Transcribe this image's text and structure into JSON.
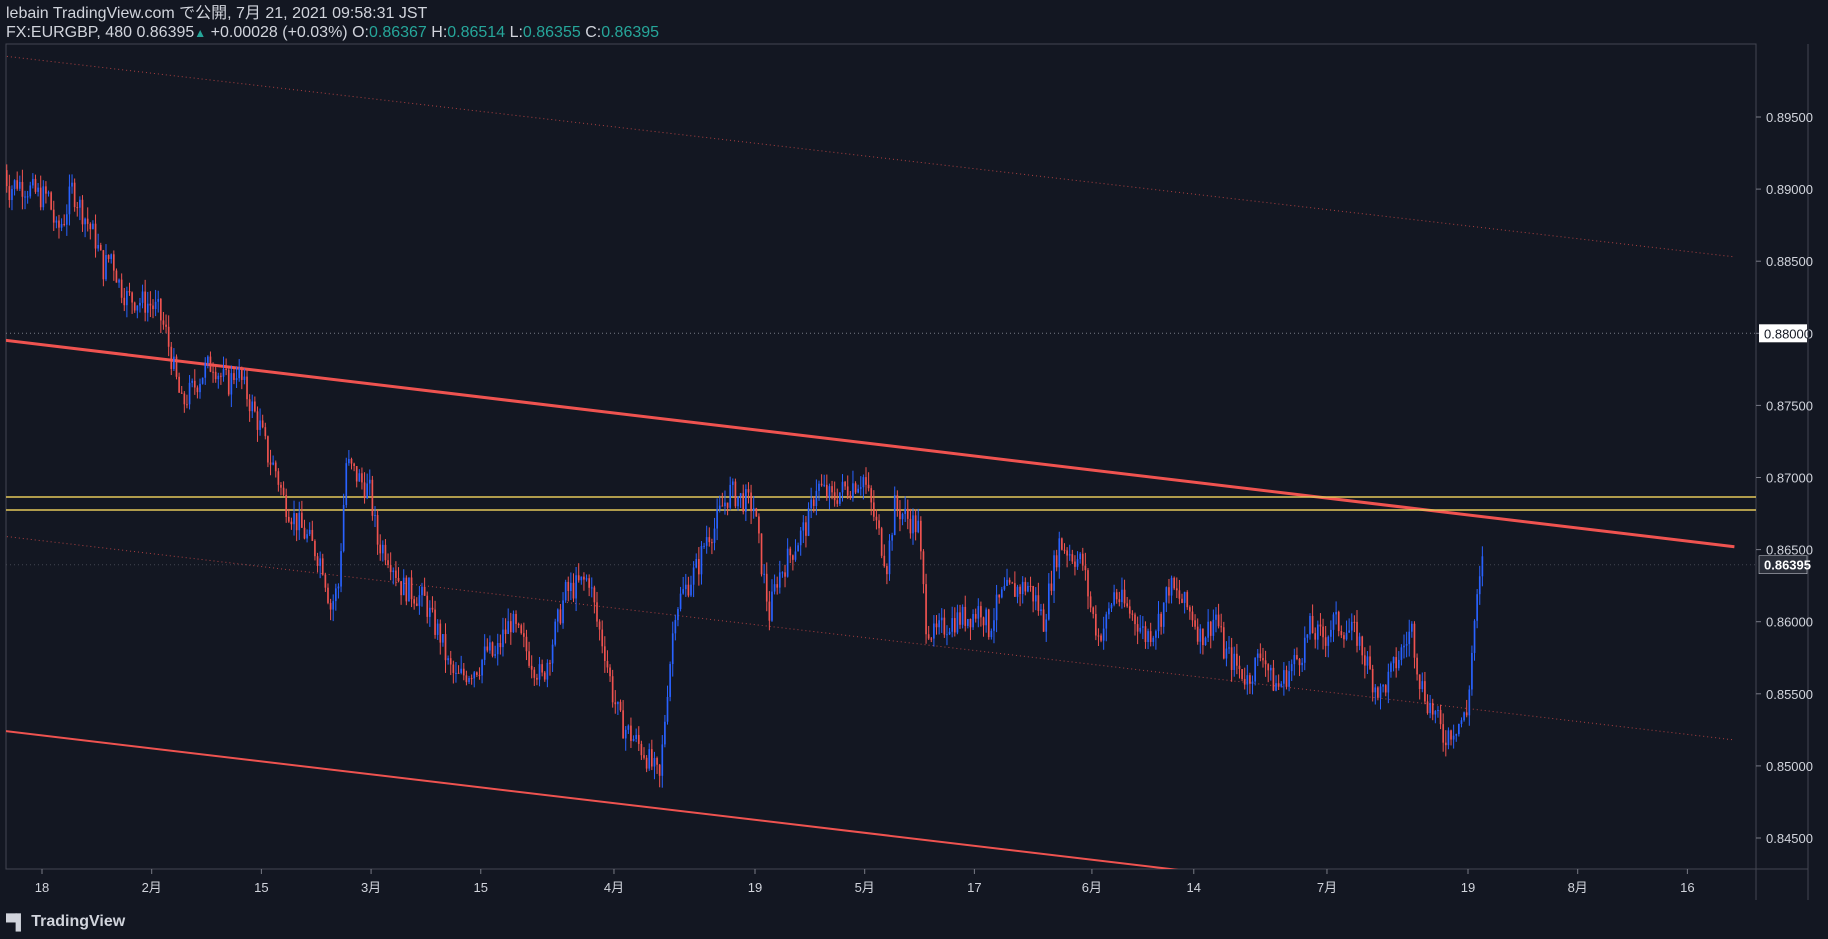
{
  "header": {
    "line1": "lebain TradingView.com で公開, 7月 21, 2021 09:58:31 JST",
    "symbol": "FX:EURGBP, 480",
    "last": "0.86395",
    "change": "+0.00028 (+0.03%)",
    "o_label": "O:",
    "o_value": "0.86367",
    "h_label": "H:",
    "h_value": "0.86514",
    "l_label": "L:",
    "l_value": "0.86355",
    "c_label": "C:",
    "c_value": "0.86395"
  },
  "logo": {
    "text": "TradingView",
    "icon": "tradingview-logo-icon"
  },
  "colors": {
    "background": "#131722",
    "up": "#2962ff",
    "down": "#ef5350",
    "trendline": "#ef5350",
    "zone": "#e5c85a",
    "text": "#d1d4dc"
  },
  "chart_data": {
    "type": "candlestick",
    "symbol": "FX:EURGBP",
    "timeframe": "480",
    "ylim": [
      0.8428,
      0.899
    ],
    "x_ticks": [
      {
        "label": "18",
        "date": "2021-01-18"
      },
      {
        "label": "2月",
        "date": "2021-02-01"
      },
      {
        "label": "15",
        "date": "2021-02-15"
      },
      {
        "label": "3月",
        "date": "2021-03-01"
      },
      {
        "label": "15",
        "date": "2021-03-15"
      },
      {
        "label": "4月",
        "date": "2021-04-01"
      },
      {
        "label": "19",
        "date": "2021-04-19"
      },
      {
        "label": "5月",
        "date": "2021-05-03"
      },
      {
        "label": "17",
        "date": "2021-05-17"
      },
      {
        "label": "6月",
        "date": "2021-06-01"
      },
      {
        "label": "14",
        "date": "2021-06-14"
      },
      {
        "label": "7月",
        "date": "2021-07-01"
      },
      {
        "label": "19",
        "date": "2021-07-19"
      },
      {
        "label": "8月",
        "date": "2021-08-02"
      },
      {
        "label": "16",
        "date": "2021-08-16"
      }
    ],
    "y_ticks": [
      "0.84500",
      "0.85000",
      "0.85500",
      "0.86000",
      "0.86500",
      "0.87000",
      "0.87500",
      "0.88000",
      "0.88500",
      "0.89000",
      "0.89500"
    ],
    "current_price": "0.86395",
    "marked_price": "0.88000",
    "path": [
      [
        "2021-01-13",
        0.892
      ],
      [
        "2021-01-14",
        0.89
      ],
      [
        "2021-01-15",
        0.8905
      ],
      [
        "2021-01-18",
        0.8895
      ],
      [
        "2021-01-19",
        0.8895
      ],
      [
        "2021-01-20",
        0.887
      ],
      [
        "2021-01-21",
        0.888
      ],
      [
        "2021-01-22",
        0.89
      ],
      [
        "2021-01-25",
        0.8865
      ],
      [
        "2021-01-26",
        0.8845
      ],
      [
        "2021-01-27",
        0.8855
      ],
      [
        "2021-01-28",
        0.8835
      ],
      [
        "2021-01-29",
        0.8825
      ],
      [
        "2021-02-01",
        0.882
      ],
      [
        "2021-02-02",
        0.8815
      ],
      [
        "2021-02-03",
        0.88
      ],
      [
        "2021-02-04",
        0.8775
      ],
      [
        "2021-02-05",
        0.875
      ],
      [
        "2021-02-08",
        0.8775
      ],
      [
        "2021-02-09",
        0.878
      ],
      [
        "2021-02-10",
        0.877
      ],
      [
        "2021-02-11",
        0.8765
      ],
      [
        "2021-02-12",
        0.8775
      ],
      [
        "2021-02-15",
        0.8735
      ],
      [
        "2021-02-16",
        0.8715
      ],
      [
        "2021-02-17",
        0.8705
      ],
      [
        "2021-02-18",
        0.8685
      ],
      [
        "2021-02-19",
        0.8675
      ],
      [
        "2021-02-22",
        0.865
      ],
      [
        "2021-02-23",
        0.864
      ],
      [
        "2021-02-24",
        0.861
      ],
      [
        "2021-02-25",
        0.8625
      ],
      [
        "2021-02-26",
        0.871
      ],
      [
        "2021-03-01",
        0.869
      ],
      [
        "2021-03-02",
        0.8655
      ],
      [
        "2021-03-03",
        0.865
      ],
      [
        "2021-03-04",
        0.864
      ],
      [
        "2021-03-05",
        0.8625
      ],
      [
        "2021-03-08",
        0.8615
      ],
      [
        "2021-03-09",
        0.86
      ],
      [
        "2021-03-10",
        0.859
      ],
      [
        "2021-03-11",
        0.857
      ],
      [
        "2021-03-12",
        0.856
      ],
      [
        "2021-03-15",
        0.857
      ],
      [
        "2021-03-16",
        0.858
      ],
      [
        "2021-03-17",
        0.8575
      ],
      [
        "2021-03-18",
        0.859
      ],
      [
        "2021-03-19",
        0.86
      ],
      [
        "2021-03-22",
        0.857
      ],
      [
        "2021-03-23",
        0.856
      ],
      [
        "2021-03-24",
        0.858
      ],
      [
        "2021-03-25",
        0.86
      ],
      [
        "2021-03-26",
        0.862
      ],
      [
        "2021-03-29",
        0.863
      ],
      [
        "2021-03-30",
        0.86
      ],
      [
        "2021-03-31",
        0.858
      ],
      [
        "2021-04-01",
        0.855
      ],
      [
        "2021-04-02",
        0.853
      ],
      [
        "2021-04-05",
        0.851
      ],
      [
        "2021-04-06",
        0.85
      ],
      [
        "2021-04-07",
        0.849
      ],
      [
        "2021-04-08",
        0.8555
      ],
      [
        "2021-04-09",
        0.861
      ],
      [
        "2021-04-12",
        0.864
      ],
      [
        "2021-04-13",
        0.866
      ],
      [
        "2021-04-14",
        0.8665
      ],
      [
        "2021-04-15",
        0.868
      ],
      [
        "2021-04-16",
        0.869
      ],
      [
        "2021-04-19",
        0.868
      ],
      [
        "2021-04-20",
        0.864
      ],
      [
        "2021-04-21",
        0.8605
      ],
      [
        "2021-04-22",
        0.863
      ],
      [
        "2021-04-23",
        0.864
      ],
      [
        "2021-04-26",
        0.867
      ],
      [
        "2021-04-27",
        0.8695
      ],
      [
        "2021-04-28",
        0.869
      ],
      [
        "2021-04-29",
        0.8685
      ],
      [
        "2021-04-30",
        0.869
      ],
      [
        "2021-05-03",
        0.87
      ],
      [
        "2021-05-04",
        0.868
      ],
      [
        "2021-05-05",
        0.866
      ],
      [
        "2021-05-06",
        0.864
      ],
      [
        "2021-05-07",
        0.868
      ],
      [
        "2021-05-10",
        0.8665
      ],
      [
        "2021-05-11",
        0.86
      ],
      [
        "2021-05-12",
        0.859
      ],
      [
        "2021-05-13",
        0.8595
      ],
      [
        "2021-05-14",
        0.86
      ],
      [
        "2021-05-17",
        0.8605
      ],
      [
        "2021-05-18",
        0.861
      ],
      [
        "2021-05-19",
        0.8595
      ],
      [
        "2021-05-20",
        0.861
      ],
      [
        "2021-05-21",
        0.862
      ],
      [
        "2021-05-24",
        0.8625
      ],
      [
        "2021-05-25",
        0.8615
      ],
      [
        "2021-05-26",
        0.86
      ],
      [
        "2021-05-27",
        0.863
      ],
      [
        "2021-05-28",
        0.8655
      ],
      [
        "2021-05-31",
        0.864
      ],
      [
        "2021-06-01",
        0.861
      ],
      [
        "2021-06-02",
        0.859
      ],
      [
        "2021-06-03",
        0.86
      ],
      [
        "2021-06-04",
        0.862
      ],
      [
        "2021-06-07",
        0.86
      ],
      [
        "2021-06-08",
        0.859
      ],
      [
        "2021-06-09",
        0.8595
      ],
      [
        "2021-06-10",
        0.8605
      ],
      [
        "2021-06-11",
        0.8625
      ],
      [
        "2021-06-14",
        0.8605
      ],
      [
        "2021-06-15",
        0.859
      ],
      [
        "2021-06-16",
        0.8595
      ],
      [
        "2021-06-17",
        0.8605
      ],
      [
        "2021-06-18",
        0.858
      ],
      [
        "2021-06-21",
        0.856
      ],
      [
        "2021-06-22",
        0.857
      ],
      [
        "2021-06-23",
        0.858
      ],
      [
        "2021-06-24",
        0.856
      ],
      [
        "2021-06-25",
        0.8555
      ],
      [
        "2021-06-28",
        0.858
      ],
      [
        "2021-06-29",
        0.8595
      ],
      [
        "2021-06-30",
        0.859
      ],
      [
        "2021-07-01",
        0.859
      ],
      [
        "2021-07-02",
        0.86
      ],
      [
        "2021-07-05",
        0.859
      ],
      [
        "2021-07-06",
        0.8575
      ],
      [
        "2021-07-07",
        0.856
      ],
      [
        "2021-07-08",
        0.855
      ],
      [
        "2021-07-09",
        0.856
      ],
      [
        "2021-07-12",
        0.8595
      ],
      [
        "2021-07-13",
        0.856
      ],
      [
        "2021-07-14",
        0.8545
      ],
      [
        "2021-07-15",
        0.8535
      ],
      [
        "2021-07-16",
        0.852
      ],
      [
        "2021-07-19",
        0.8535
      ],
      [
        "2021-07-20",
        0.86
      ],
      [
        "2021-07-21",
        0.864
      ]
    ],
    "trendlines": [
      {
        "name": "resistance",
        "style": "solid-thick",
        "p1": [
          "2021-01-12",
          0.8796
        ],
        "p2": [
          "2021-08-22",
          0.8652
        ]
      },
      {
        "name": "support",
        "style": "solid",
        "p1": [
          "2021-01-12",
          0.8525
        ],
        "p2": [
          "2021-06-18",
          0.8424
        ]
      },
      {
        "name": "channel-top",
        "style": "dotted",
        "p1": [
          "2021-01-12",
          0.8993
        ],
        "p2": [
          "2021-08-22",
          0.8853
        ]
      },
      {
        "name": "channel-mid",
        "style": "dotted",
        "p1": [
          "2021-01-12",
          0.866
        ],
        "p2": [
          "2021-08-22",
          0.8518
        ]
      }
    ],
    "horizontal_zone": [
      0.86775,
      0.86865
    ],
    "grid": false
  }
}
